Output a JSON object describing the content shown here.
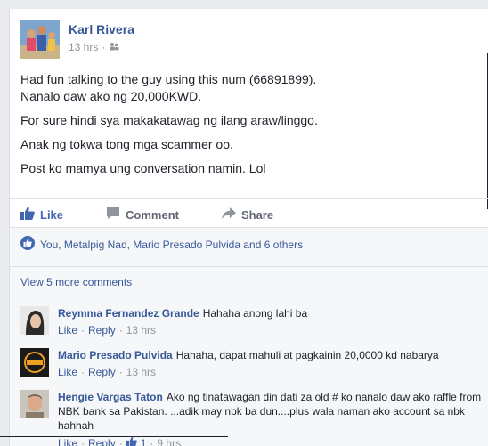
{
  "post": {
    "author": "Karl Rivera",
    "time": "13 hrs",
    "dot": "·",
    "lines": [
      "Had fun talking to the guy using this num (66891899).",
      "Nanalo daw ako ng 20,000KWD.",
      "For sure hindi sya makakatawag ng ilang araw/linggo.",
      "Anak ng tokwa tong mga scammer oo.",
      "Post ko mamya ung conversation namin. Lol"
    ]
  },
  "actions": {
    "like": "Like",
    "comment": "Comment",
    "share": "Share"
  },
  "likes_summary": "You, Metalpig Nad, Mario Presado Pulvida and 6 others",
  "view_more": "View 5 more comments",
  "comments": [
    {
      "name": "Reymma Fernandez Grande",
      "text": "Hahaha anong lahi ba",
      "like": "Like",
      "reply": "Reply",
      "time": "13 hrs"
    },
    {
      "name": "Mario Presado Pulvida",
      "text": "Hahaha, dapat mahuli at pagkainin 20,0000 kd nabarya",
      "like": "Like",
      "reply": "Reply",
      "time": "13 hrs"
    },
    {
      "name": "Hengie Vargas Taton",
      "text": "Ako ng tinatawagan din dati za old # ko nanalo daw ako raffle from NBK bank sa Pakistan. ...adik may nbk ba dun....plus wala naman ako account sa nbk hahhah",
      "like": "Like",
      "reply": "Reply",
      "likes_count": "1",
      "time": "9 hrs"
    }
  ],
  "colors": {
    "link": "#365899",
    "like_blue": "#4267b2",
    "muted": "#90949c"
  }
}
